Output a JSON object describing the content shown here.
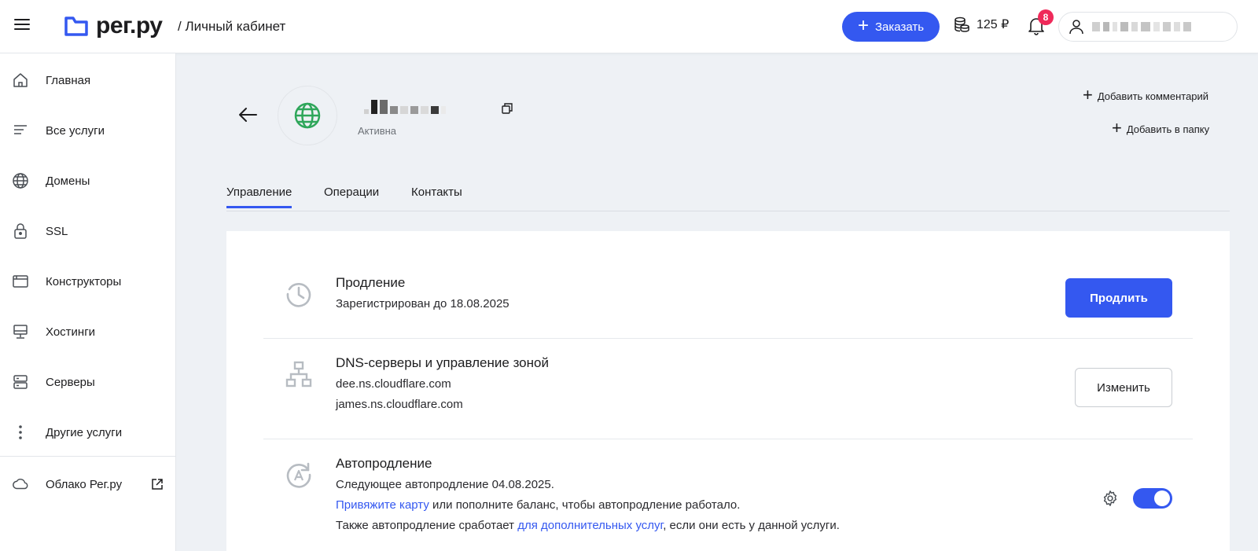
{
  "header": {
    "logo_text": "рег.ру",
    "subtitle": "/ Личный кабинет",
    "order_button": "Заказать",
    "balance": "125 ₽",
    "notifications_count": "8",
    "accent_color": "#3458f0",
    "badge_color": "#ef2a5a"
  },
  "sidebar": {
    "items": [
      {
        "label": "Главная",
        "icon": "home-icon"
      },
      {
        "label": "Все услуги",
        "icon": "list-icon"
      },
      {
        "label": "Домены",
        "icon": "globe-icon"
      },
      {
        "label": "SSL",
        "icon": "lock-icon"
      },
      {
        "label": "Конструкторы",
        "icon": "browser-window-icon"
      },
      {
        "label": "Хостинги",
        "icon": "monitor-icon"
      },
      {
        "label": "Серверы",
        "icon": "server-icon"
      },
      {
        "label": "Другие услуги",
        "icon": "more-vertical-icon"
      }
    ],
    "cloud": {
      "label": "Облако Рег.ру",
      "icon": "cloud-icon"
    }
  },
  "service": {
    "status": "Активна",
    "add_comment": "Добавить комментарий",
    "add_folder": "Добавить в папку"
  },
  "tabs": [
    {
      "label": "Управление",
      "active": true
    },
    {
      "label": "Операции",
      "active": false
    },
    {
      "label": "Контакты",
      "active": false
    }
  ],
  "renewal": {
    "title": "Продление",
    "text": "Зарегистрирован до 18.08.2025",
    "button": "Продлить"
  },
  "dns": {
    "title": "DNS-серверы и управление зоной",
    "servers": [
      "dee.ns.cloudflare.com",
      "james.ns.cloudflare.com"
    ],
    "button": "Изменить"
  },
  "autorenew": {
    "title": "Автопродление",
    "line1": "Следующее автопродление 04.08.2025.",
    "line2_link": "Привяжите карту",
    "line2_rest": " или пополните баланс, чтобы автопродление работало.",
    "line3_start": "Также автопродление сработает ",
    "line3_link": "для дополнительных услуг",
    "line3_end": ", если они есть у данной услуги.",
    "enabled": true
  }
}
